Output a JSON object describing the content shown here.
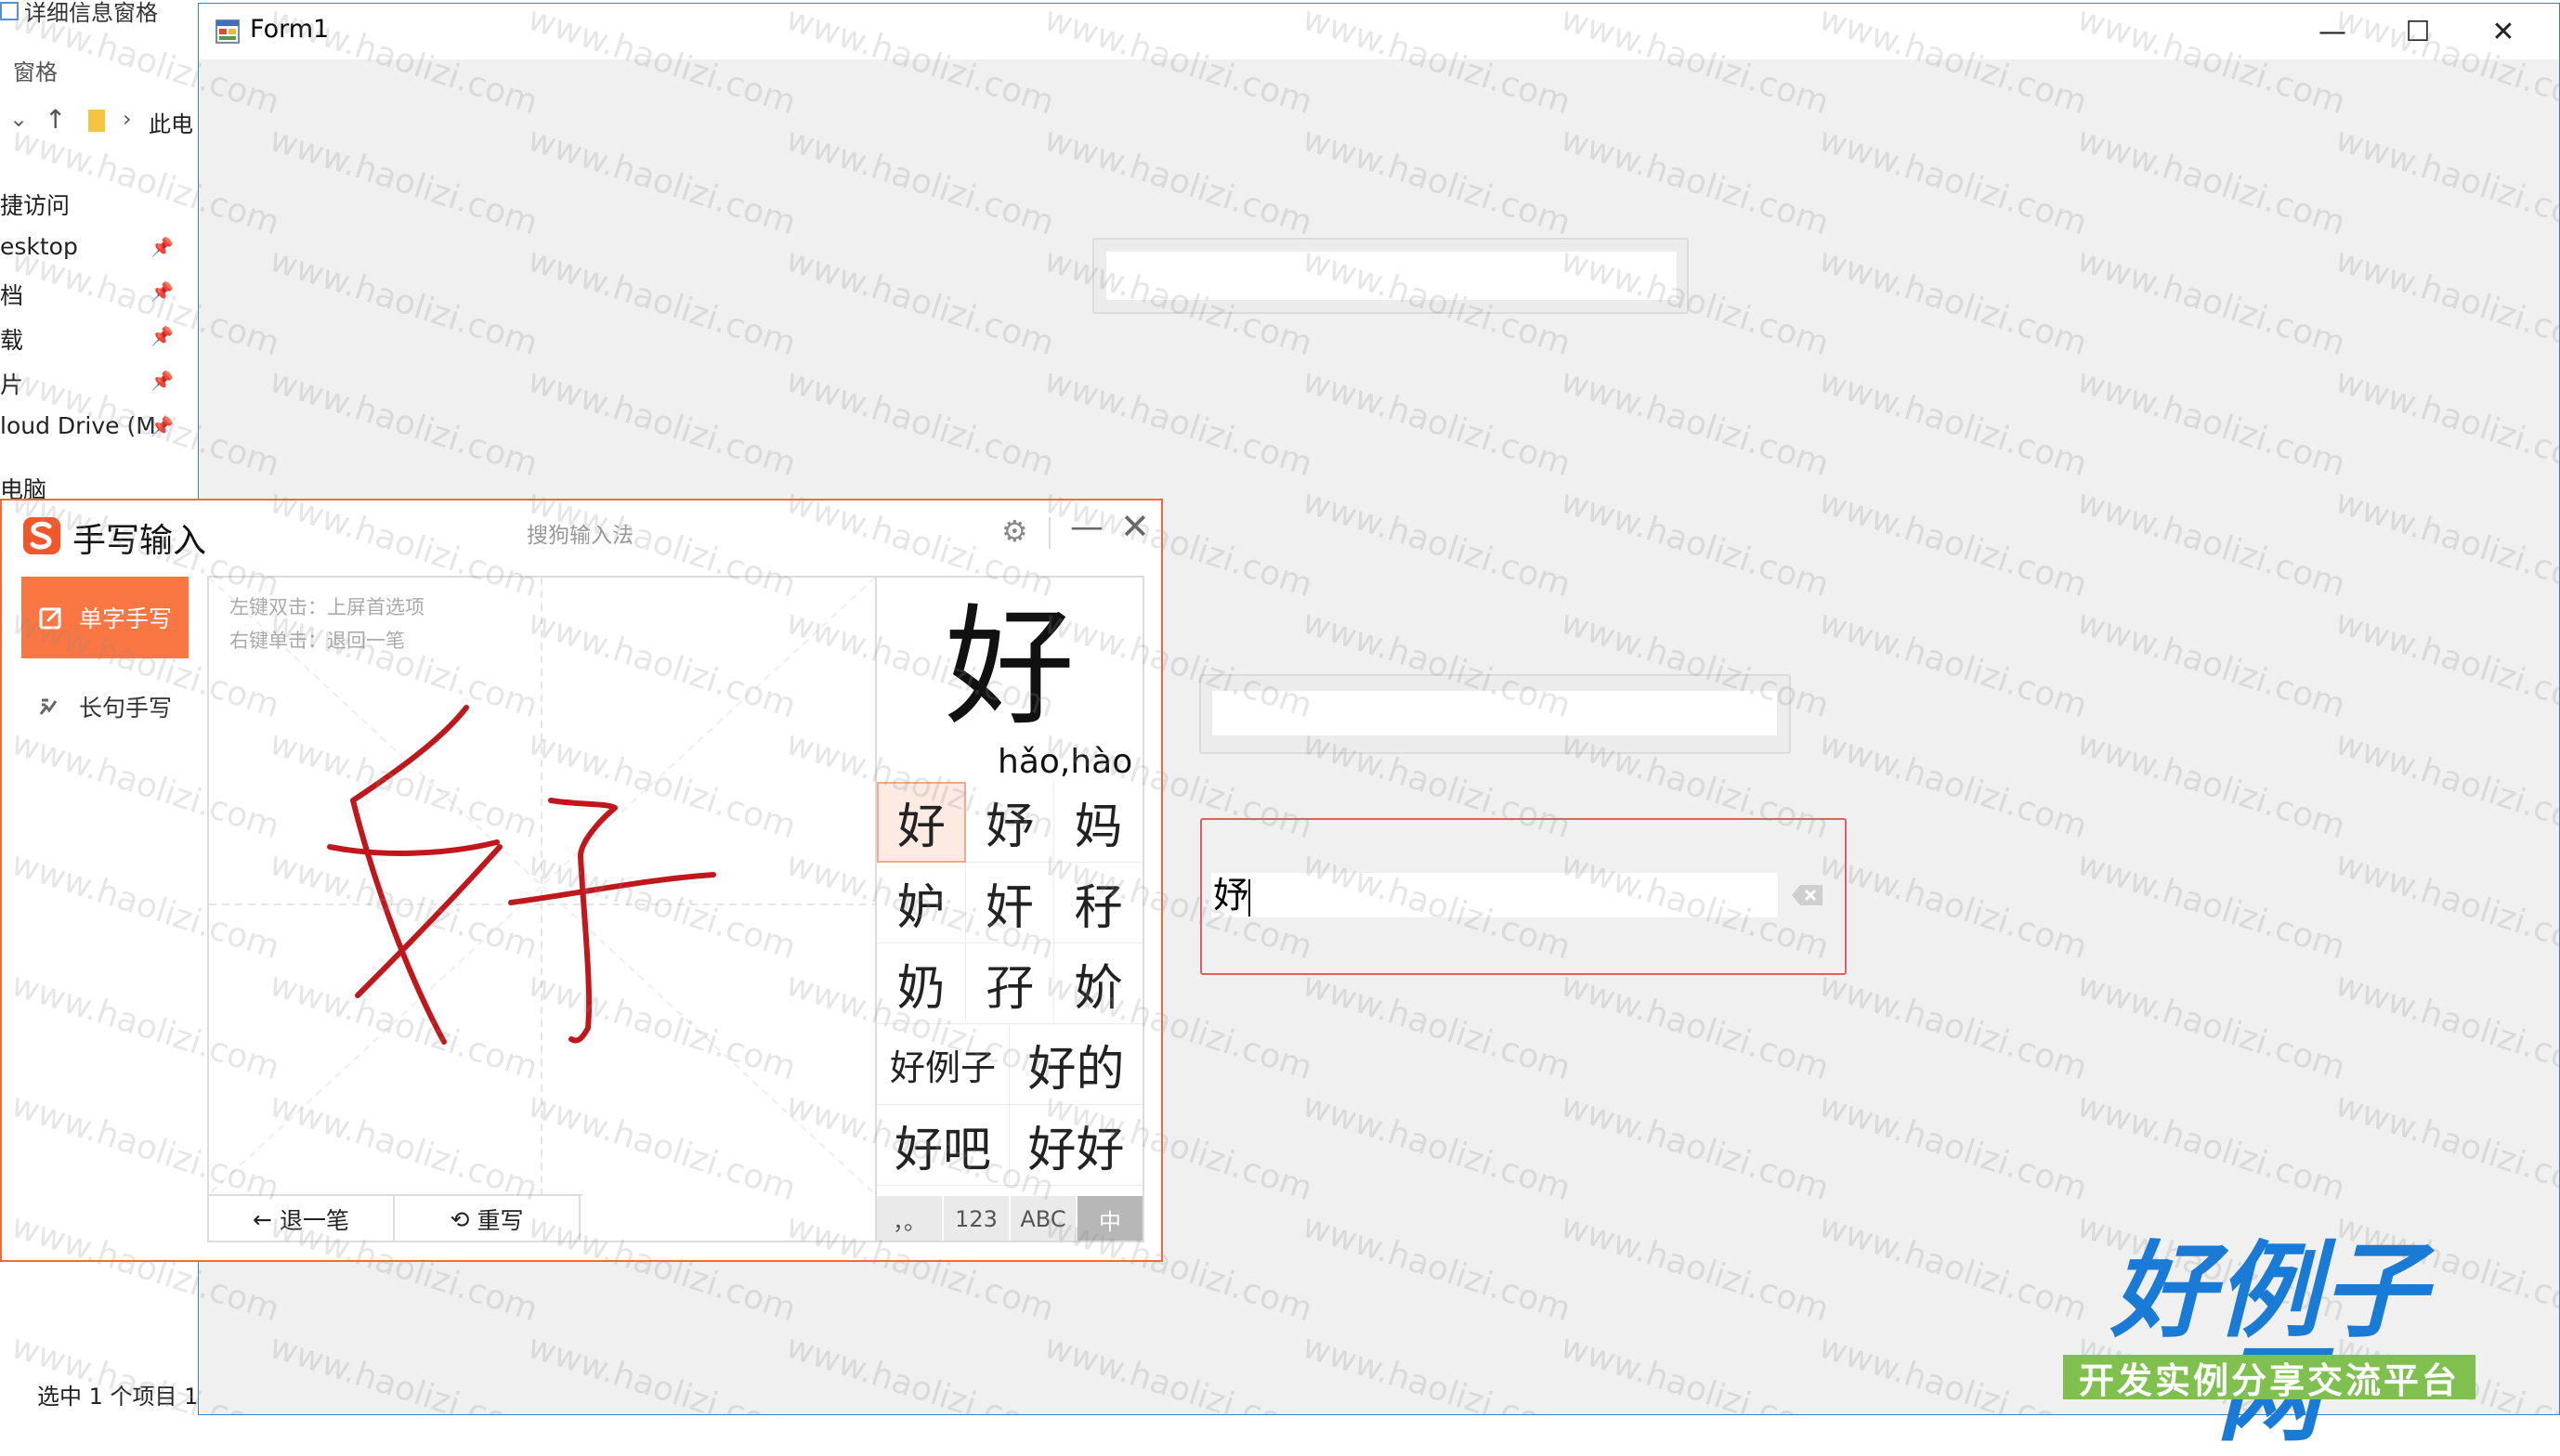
{
  "explorer": {
    "menu_details_pane": "详细信息窗格",
    "menu_pane": "窗格",
    "address_partial": "此电",
    "nav_items": [
      {
        "label": "捷访问",
        "pinned": false
      },
      {
        "label": "esktop",
        "pinned": true
      },
      {
        "label": "档",
        "pinned": true
      },
      {
        "label": "载",
        "pinned": true
      },
      {
        "label": "片",
        "pinned": true
      },
      {
        "label": "loud Drive (M",
        "pinned": true
      },
      {
        "label": "电脑",
        "pinned": false
      }
    ],
    "status": "选中 1 个项目  1"
  },
  "form1": {
    "title": "Form1",
    "minimize_glyph": "—",
    "maximize_glyph": "☐",
    "close_glyph": "✕",
    "textbox_top": "",
    "textbox_middle": "",
    "textbox_active_value": "妤"
  },
  "ime": {
    "title": "手写输入",
    "brand": "搜狗输入法",
    "settings_glyph": "⚙",
    "minimize_glyph": "—",
    "close_glyph": "✕",
    "mode_single": "单字手写",
    "mode_sentence": "长句手写",
    "hint_line1": "左键双击：上屏首选项",
    "hint_line2": "右键单击：退回一笔",
    "undo_label": "退一笔",
    "rewrite_label": "重写",
    "preview_char": "好",
    "preview_pinyin": "hǎo,hào",
    "candidates": [
      "好",
      "妤",
      "妈",
      "妒",
      "奸",
      "秄",
      "奶",
      "孖",
      "妎"
    ],
    "phrases": [
      "好例子",
      "好的",
      "好吧",
      "好好"
    ],
    "keyboard": [
      "，。",
      "123",
      "ABC",
      "中"
    ],
    "active_keyboard": "中"
  },
  "watermark": {
    "text": "www.haolizi.com",
    "logo_title": "好例子网",
    "logo_subtitle": "开发实例分享交流平台"
  },
  "colors": {
    "ime_accent": "#fa7642",
    "ink": "#c0171d",
    "form_active_border": "#e06060",
    "logo_blue": "#1a7bd6",
    "logo_green": "#7fc04e"
  }
}
